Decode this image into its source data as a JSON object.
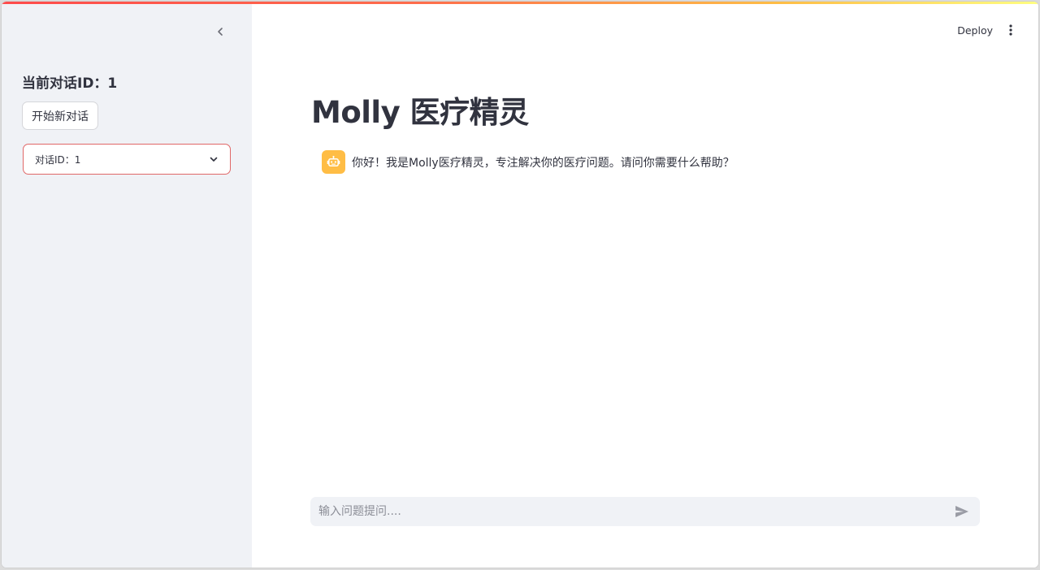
{
  "colors": {
    "accent": "#ff4b4b",
    "sidebar_bg": "#f0f2f6",
    "avatar_bg": "#ffbd45",
    "select_border": "#e06868",
    "text": "#31333f"
  },
  "sidebar": {
    "collapse_icon": "chevron-left-icon",
    "title": "当前对话ID：1",
    "new_chat_label": "开始新对话",
    "select": {
      "selected_value": "对话ID：1",
      "icon": "chevron-down-icon"
    }
  },
  "header": {
    "deploy_label": "Deploy",
    "menu_icon": "more-vertical-icon"
  },
  "main": {
    "title": "Molly 医疗精灵",
    "messages": [
      {
        "role": "assistant",
        "avatar_icon": "robot-icon",
        "text": "你好！我是Molly医疗精灵，专注解决你的医疗问题。请问你需要什么帮助？"
      }
    ],
    "chat_input": {
      "placeholder": "输入问题提问....",
      "value": "",
      "send_icon": "send-icon"
    }
  }
}
